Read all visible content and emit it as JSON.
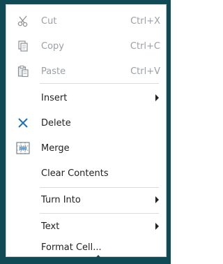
{
  "menu": {
    "items": [
      {
        "id": "cut",
        "label": "Cut",
        "shortcut": "Ctrl+X",
        "icon": "scissors-icon",
        "disabled": true
      },
      {
        "id": "copy",
        "label": "Copy",
        "shortcut": "Ctrl+C",
        "icon": "copy-icon",
        "disabled": true
      },
      {
        "id": "paste",
        "label": "Paste",
        "shortcut": "Ctrl+V",
        "icon": "paste-icon",
        "disabled": true
      },
      {
        "id": "insert",
        "label": "Insert",
        "submenu": true
      },
      {
        "id": "delete",
        "label": "Delete",
        "icon": "close-icon"
      },
      {
        "id": "merge",
        "label": "Merge",
        "icon": "merge-cells-icon"
      },
      {
        "id": "clear",
        "label": "Clear Contents"
      },
      {
        "id": "turn-into",
        "label": "Turn Into",
        "submenu": true
      },
      {
        "id": "text",
        "label": "Text",
        "submenu": true
      },
      {
        "id": "format-cell",
        "label": "Format Cell..."
      }
    ]
  },
  "colors": {
    "backdrop": "#0f4a55",
    "disabled_text": "#9aa0a6",
    "delete_icon": "#1f6fbf"
  }
}
